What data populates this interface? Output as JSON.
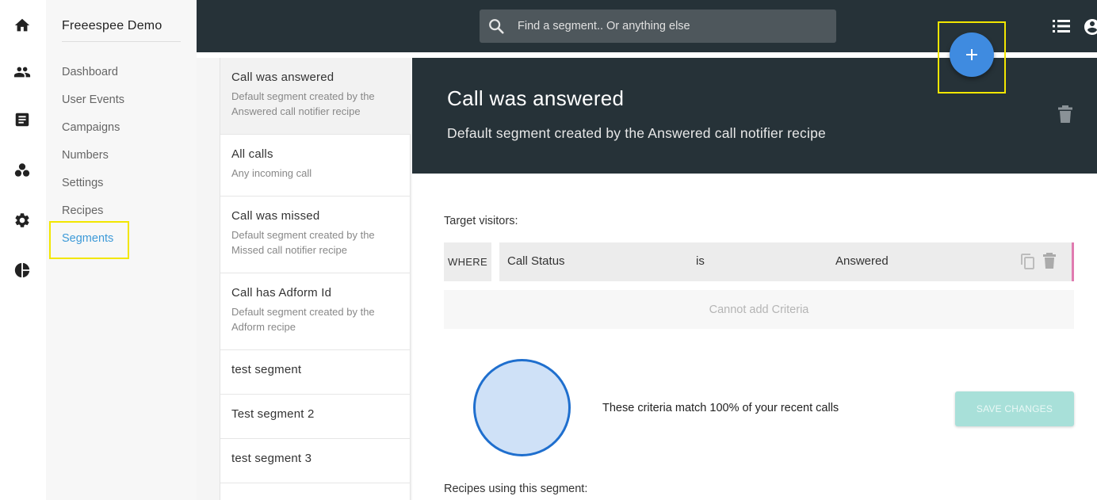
{
  "rail": {
    "icons": [
      "home-icon",
      "people-icon",
      "document-icon",
      "segments-icon",
      "gear-icon",
      "pie-chart-icon"
    ]
  },
  "nav": {
    "title": "Freeespee Demo",
    "items": [
      {
        "label": "Dashboard"
      },
      {
        "label": "User Events"
      },
      {
        "label": "Campaigns"
      },
      {
        "label": "Numbers"
      },
      {
        "label": "Settings"
      },
      {
        "label": "Recipes"
      },
      {
        "label": "Segments",
        "active": true
      }
    ]
  },
  "topbar": {
    "search_placeholder": "Find a segment.. Or anything else"
  },
  "segments": [
    {
      "name": "Call was answered",
      "desc": "Default segment created by the Answered call notifier recipe",
      "selected": true
    },
    {
      "name": "All calls",
      "desc": "Any incoming call"
    },
    {
      "name": "Call was missed",
      "desc": "Default segment created by the Missed call notifier recipe"
    },
    {
      "name": "Call has Adform Id",
      "desc": "Default segment created by the Adform recipe"
    },
    {
      "name": "test segment",
      "desc": ""
    },
    {
      "name": "Test segment 2",
      "desc": ""
    },
    {
      "name": "test segment 3",
      "desc": ""
    }
  ],
  "detail": {
    "title": "Call was answered",
    "description": "Default segment created by the Answered call notifier recipe",
    "target_label": "Target visitors:",
    "where_label": "WHERE",
    "criteria": {
      "field": "Call Status",
      "operator": "is",
      "value": "Answered"
    },
    "add_criteria_label": "Cannot add Criteria",
    "match_text": "These criteria match 100% of your recent calls",
    "match_percent": 100,
    "save_label": "SAVE CHANGES",
    "recipes_label": "Recipes using this segment:"
  },
  "colors": {
    "topbar": "#263238",
    "accent": "#3d9ad8",
    "fab": "#3f8be0",
    "highlight": "#f2e600",
    "save_button": "#a8e0d9"
  }
}
